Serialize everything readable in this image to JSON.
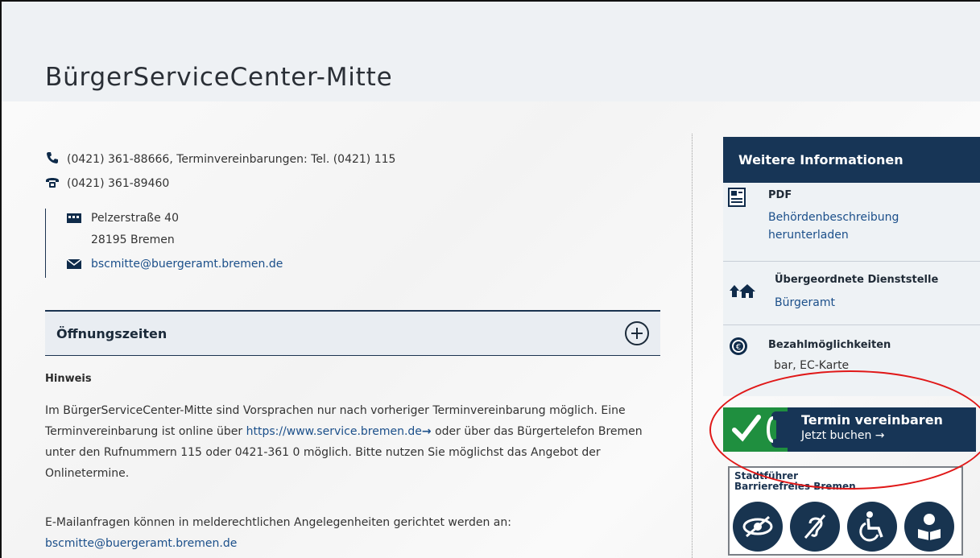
{
  "page": {
    "title": "BürgerServiceCenter-Mitte"
  },
  "contact": {
    "phone": "(0421) 361-88666, Terminvereinbarungen: Tel. (0421) 115",
    "fax": "(0421) 361-89460",
    "street": "Pelzerstraße 40",
    "city": "28195 Bremen",
    "email": "bscmitte@buergeramt.bremen.de"
  },
  "opening_hours": {
    "title": "Öffnungszeiten"
  },
  "notice": {
    "heading": "Hinweis",
    "para1_before": "Im BürgerServiceCenter-Mitte sind Vorsprachen nur nach vorheriger Terminvereinbarung möglich. Eine Terminvereinbarung ist online über ",
    "para1_link": "https://www.service.bremen.de",
    "para1_after": " oder über das Bürgertelefon Bremen unter den Rufnummern 115 oder 0421-361 0 möglich. Bitte nutzen Sie möglichst das Angebot der Onlinetermine.",
    "para2": "E-Mailanfragen können in melderechtlichen Angelegenheiten gerichtet werden an:",
    "para2_link": "bscmitte@buergeramt.bremen.de"
  },
  "sidebar": {
    "title": "Weitere Informationen",
    "pdf_title": "PDF",
    "pdf_link_1": "Behördenbeschreibung",
    "pdf_link_2": "herunterladen",
    "parent_title": "Übergeordnete Dienststelle",
    "parent_link": "Bürgeramt",
    "payment_title": "Bezahlmöglichkeiten",
    "payment_value": "bar, EC-Karte"
  },
  "cta": {
    "title": "Termin vereinbaren",
    "subtitle": "Jetzt buchen →"
  },
  "guide": {
    "title_line1": "Stadtführer",
    "title_line2": "Barrierefreies Bremen"
  },
  "colors": {
    "navy": "#173556",
    "green": "#1f8f3f",
    "link": "#1b4f8a",
    "annotation": "#e01818"
  }
}
